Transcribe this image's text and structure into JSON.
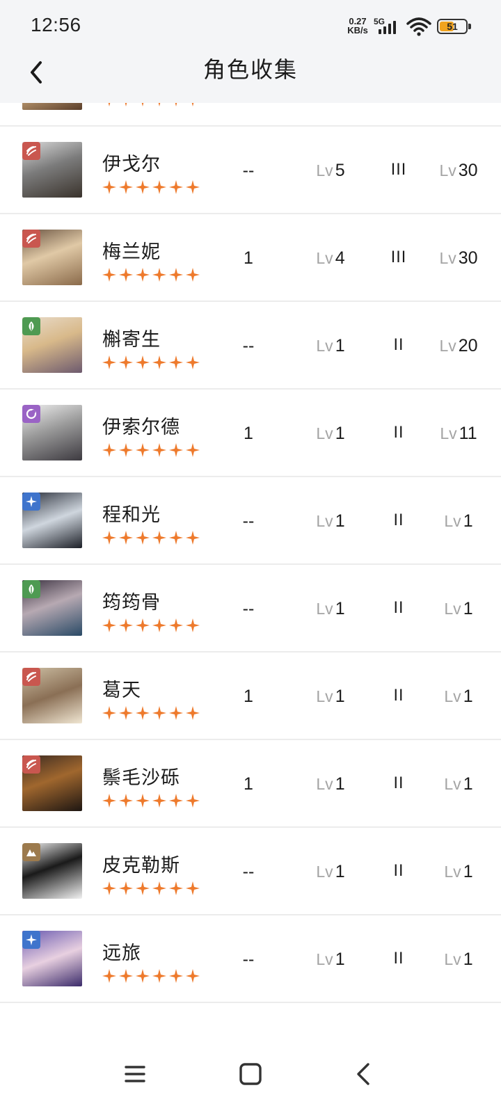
{
  "status": {
    "time": "12:56",
    "speed": "0.27",
    "speed_unit": "KB/s",
    "network": "5G",
    "battery": "51",
    "battery_level": 0.51
  },
  "header": {
    "title": "角色收集"
  },
  "lv_prefix": "Lv",
  "colors": {
    "star": "#ee7a2c",
    "badge_red": "#c9574f",
    "badge_green": "#4e9a52",
    "badge_purple": "#9a63c5",
    "badge_blue": "#3f74cc",
    "badge_brown": "#9c7a4d"
  },
  "characters": [
    {
      "name": "",
      "stars": 6,
      "badge": "hand-icon",
      "badge_color": "#c9574f",
      "dup": "",
      "lv1": "",
      "tier": "",
      "lv2": ""
    },
    {
      "name": "伊戈尔",
      "stars": 6,
      "badge": "hand-icon",
      "badge_color": "#c9574f",
      "dup": "--",
      "lv1": "5",
      "tier": "III",
      "lv2": "30"
    },
    {
      "name": "梅兰妮",
      "stars": 6,
      "badge": "hand-icon",
      "badge_color": "#c9574f",
      "dup": "1",
      "lv1": "4",
      "tier": "III",
      "lv2": "30"
    },
    {
      "name": "槲寄生",
      "stars": 6,
      "badge": "leaf-icon",
      "badge_color": "#4e9a52",
      "dup": "--",
      "lv1": "1",
      "tier": "II",
      "lv2": "20"
    },
    {
      "name": "伊索尔德",
      "stars": 6,
      "badge": "moon-icon",
      "badge_color": "#9a63c5",
      "dup": "1",
      "lv1": "1",
      "tier": "II",
      "lv2": "11"
    },
    {
      "name": "程和光",
      "stars": 6,
      "badge": "star-icon",
      "badge_color": "#3f74cc",
      "dup": "--",
      "lv1": "1",
      "tier": "II",
      "lv2": "1"
    },
    {
      "name": "筠筠骨",
      "stars": 6,
      "badge": "leaf-icon",
      "badge_color": "#4e9a52",
      "dup": "--",
      "lv1": "1",
      "tier": "II",
      "lv2": "1"
    },
    {
      "name": "葛天",
      "stars": 6,
      "badge": "hand-icon",
      "badge_color": "#c9574f",
      "dup": "1",
      "lv1": "1",
      "tier": "II",
      "lv2": "1"
    },
    {
      "name": "鬃毛沙砾",
      "stars": 6,
      "badge": "hand-icon",
      "badge_color": "#c9574f",
      "dup": "1",
      "lv1": "1",
      "tier": "II",
      "lv2": "1"
    },
    {
      "name": "皮克勒斯",
      "stars": 6,
      "badge": "mountain-icon",
      "badge_color": "#9c7a4d",
      "dup": "--",
      "lv1": "1",
      "tier": "II",
      "lv2": "1"
    },
    {
      "name": "远旅",
      "stars": 6,
      "badge": "star-icon",
      "badge_color": "#3f74cc",
      "dup": "--",
      "lv1": "1",
      "tier": "II",
      "lv2": "1"
    }
  ],
  "navigation": {
    "menu": "menu-icon",
    "home": "home-square-icon",
    "back": "back-chevron-icon"
  }
}
